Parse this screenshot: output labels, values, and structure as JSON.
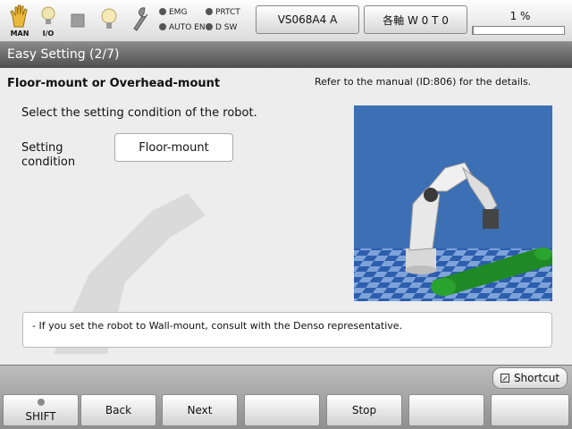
{
  "status": {
    "icons": [
      {
        "name": "man-hand-icon",
        "caption": "MAN"
      },
      {
        "name": "io-bulb-icon",
        "caption": "I/O"
      },
      {
        "name": "stop-square-icon",
        "caption": ""
      },
      {
        "name": "bulb-icon",
        "caption": ""
      },
      {
        "name": "wrench-icon",
        "caption": ""
      }
    ],
    "lamps": {
      "emg": "EMG",
      "prtct": "PRTCT",
      "auto_en": "AUTO EN",
      "dsw": "D SW"
    },
    "robot_model": "VS068A4 A",
    "axis_mode": "各軸  W 0 T 0",
    "speed_percent": "1 %",
    "speed_value": 0.01
  },
  "title": "Easy Setting (2/7)",
  "main": {
    "heading": "Floor-mount or Overhead-mount",
    "reference": "Refer to the manual (ID:806) for the details.",
    "instruction": "Select the setting condition of the robot.",
    "setting_label": "Setting condition",
    "setting_value": "Floor-mount",
    "note": "- If you set the robot to Wall-mount, consult with the Denso representative."
  },
  "shortcut_label": "Shortcut",
  "function_keys": [
    "SHIFT",
    "Back",
    "Next",
    "",
    "Stop",
    "",
    ""
  ],
  "colors": {
    "sky": "#3c6fb4",
    "floor_light": "#7b9fd6",
    "floor_dark": "#2c5bab",
    "conveyor": "#1f8a25",
    "progress": "#4d8ad1"
  }
}
